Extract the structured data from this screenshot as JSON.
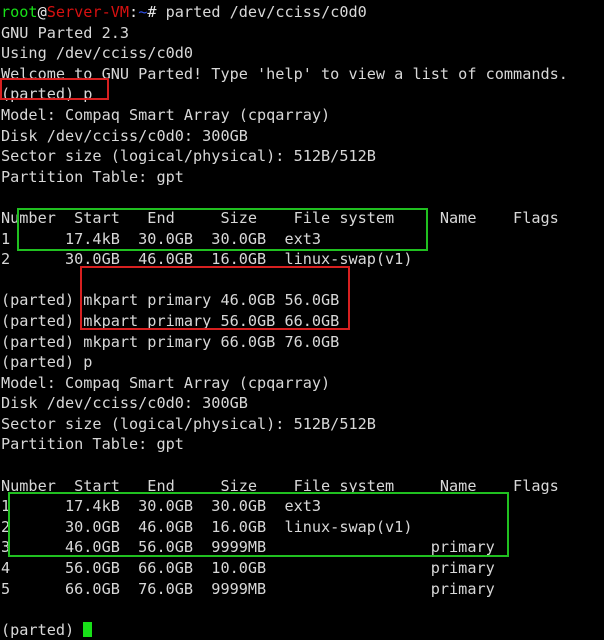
{
  "terminal": {
    "background_color": "#000000",
    "foreground_color": "#d8d8d8",
    "cursor_color": "#18e018",
    "prompt": {
      "user": "root",
      "at": "@",
      "host": "Server-VM",
      "colon": ":",
      "path": "~",
      "sigil": "# ",
      "user_color": "#18e018",
      "host_color": "#d81010",
      "path_color": "#3050e8"
    },
    "lines": {
      "cmd_parted": "parted /dev/cciss/c0d0",
      "banner_version": "GNU Parted 2.3",
      "banner_using": "Using /dev/cciss/c0d0",
      "banner_welcome": "Welcome to GNU Parted! Type 'help' to view a list of commands.",
      "prompt_p_1": "(parted) p",
      "model_1": "Model: Compaq Smart Array (cpqarray)",
      "disk_1": "Disk /dev/cciss/c0d0: 300GB",
      "sector_1": "Sector size (logical/physical): 512B/512B",
      "ptable_1": "Partition Table: gpt",
      "table_header_1": "Number  Start   End     Size    File system     Name    Flags",
      "row_1_1": "1      17.4kB  30.0GB  30.0GB  ext3",
      "row_1_2": "2      30.0GB  46.0GB  16.0GB  linux-swap(v1)",
      "mkpart_1": "mkpart primary 46.0GB 56.0GB",
      "mkpart_2": "mkpart primary 56.0GB 66.0GB",
      "mkpart_3": "mkpart primary 66.0GB 76.0GB",
      "prompt_label": "(parted) ",
      "prompt_p_2": "(parted) p",
      "model_2": "Model: Compaq Smart Array (cpqarray)",
      "disk_2": "Disk /dev/cciss/c0d0: 300GB",
      "sector_2": "Sector size (logical/physical): 512B/512B",
      "ptable_2": "Partition Table: gpt",
      "table_header_2": "Number  Start   End     Size    File system     Name    Flags",
      "row_2_1": "1      17.4kB  30.0GB  30.0GB  ext3",
      "row_2_2": "2      30.0GB  46.0GB  16.0GB  linux-swap(v1)",
      "row_2_3": "3      46.0GB  56.0GB  9999MB                  primary",
      "row_2_4": "4      56.0GB  66.0GB  10.0GB                  primary",
      "row_2_5": "5      66.0GB  76.0GB  9999MB                  primary",
      "prompt_final": "(parted) "
    },
    "highlights": {
      "box_1_color": "#d82020",
      "box_2_color": "#20c020",
      "box_3_color": "#d82020",
      "box_4_color": "#20c020"
    }
  },
  "chart_data": {
    "type": "table",
    "title": "GNU Parted partition listing for /dev/cciss/c0d0",
    "disk_model": "Compaq Smart Array (cpqarray)",
    "disk_size": "300GB",
    "sector_size_logical": "512B",
    "sector_size_physical": "512B",
    "partition_table": "gpt",
    "columns": [
      "Number",
      "Start",
      "End",
      "Size",
      "File system",
      "Name",
      "Flags"
    ],
    "before": [
      [
        "1",
        "17.4kB",
        "30.0GB",
        "30.0GB",
        "ext3",
        "",
        ""
      ],
      [
        "2",
        "30.0GB",
        "46.0GB",
        "16.0GB",
        "linux-swap(v1)",
        "",
        ""
      ]
    ],
    "commands": [
      "mkpart primary 46.0GB 56.0GB",
      "mkpart primary 56.0GB 66.0GB",
      "mkpart primary 66.0GB 76.0GB"
    ],
    "after": [
      [
        "1",
        "17.4kB",
        "30.0GB",
        "30.0GB",
        "ext3",
        "",
        ""
      ],
      [
        "2",
        "30.0GB",
        "46.0GB",
        "16.0GB",
        "linux-swap(v1)",
        "",
        ""
      ],
      [
        "3",
        "46.0GB",
        "56.0GB",
        "9999MB",
        "",
        "primary",
        ""
      ],
      [
        "4",
        "56.0GB",
        "66.0GB",
        "10.0GB",
        "",
        "primary",
        ""
      ],
      [
        "5",
        "66.0GB",
        "76.0GB",
        "9999MB",
        "",
        "primary",
        ""
      ]
    ]
  }
}
